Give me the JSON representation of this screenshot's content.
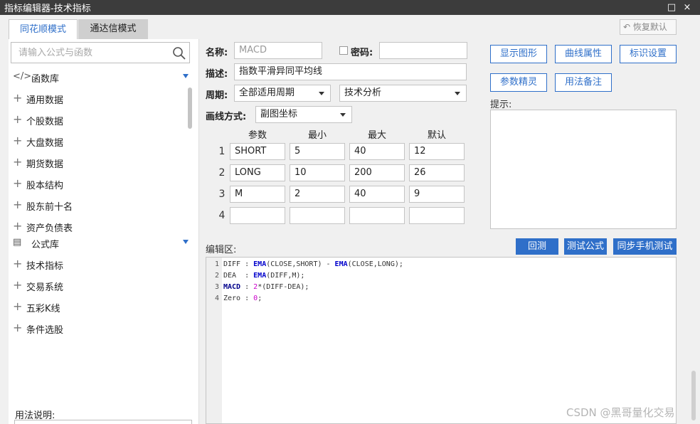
{
  "window": {
    "title": "指标编辑器-技术指标",
    "minimize_glyph": "□",
    "close_glyph": "×"
  },
  "tabs": [
    {
      "label": "同花顺模式",
      "active": true
    },
    {
      "label": "通达信模式",
      "active": false
    }
  ],
  "restore_button": {
    "label": "恢复默认",
    "icon": "undo-icon",
    "glyph": "↶"
  },
  "sidebar": {
    "search": {
      "placeholder": "请输入公式与函数",
      "icon": "search-icon"
    },
    "function_lib": {
      "label": "函数库",
      "icon_glyph": "</>"
    },
    "function_items": [
      "通用数据",
      "个股数据",
      "大盘数据",
      "期货数据",
      "股本结构",
      "股东前十名",
      "资产负债表"
    ],
    "formula_lib": {
      "label": "公式库",
      "icon_glyph": "▤"
    },
    "formula_items": [
      "技术指标",
      "交易系统",
      "五彩K线",
      "条件选股"
    ],
    "plus_glyph": "+",
    "usage_label": "用法说明:"
  },
  "form": {
    "name": {
      "label": "名称:",
      "value": "MACD"
    },
    "password": {
      "label": "密码:",
      "value": ""
    },
    "description": {
      "label": "描述:",
      "value": "指数平滑异同平均线"
    },
    "period": {
      "label": "周期:",
      "value": "全部适用周期"
    },
    "category": {
      "value": "技术分析"
    },
    "draw_mode": {
      "label": "画线方式:",
      "value": "副图坐标"
    }
  },
  "params": {
    "headers": [
      "参数",
      "最小",
      "最大",
      "默认"
    ],
    "rows": [
      {
        "num": "1",
        "name": "SHORT",
        "min": "5",
        "max": "40",
        "default": "12"
      },
      {
        "num": "2",
        "name": "LONG",
        "min": "10",
        "max": "200",
        "default": "26"
      },
      {
        "num": "3",
        "name": "M",
        "min": "2",
        "max": "40",
        "default": "9"
      },
      {
        "num": "4",
        "name": "",
        "min": "",
        "max": "",
        "default": ""
      }
    ]
  },
  "right_buttons": {
    "show_graph": "显示图形",
    "curve_props": "曲线属性",
    "marker_settings": "标识设置",
    "param_wizard": "参数精灵",
    "usage_notes": "用法备注"
  },
  "hint_label": "提示:",
  "editor": {
    "label": "编辑区:",
    "buttons": {
      "backtest": "回测",
      "test_formula": "测试公式",
      "sync_mobile": "同步手机测试"
    },
    "line_numbers": [
      "1",
      "2",
      "3",
      "4"
    ],
    "lines": [
      [
        {
          "t": "DIFF : ",
          "k": "plain"
        },
        {
          "t": "EMA",
          "k": "fn"
        },
        {
          "t": "(CLOSE,SHORT) - ",
          "k": "plain"
        },
        {
          "t": "EMA",
          "k": "fn"
        },
        {
          "t": "(CLOSE,LONG);",
          "k": "plain"
        }
      ],
      [
        {
          "t": "DEA  : ",
          "k": "plain"
        },
        {
          "t": "EMA",
          "k": "fn"
        },
        {
          "t": "(DIFF,M);",
          "k": "plain"
        }
      ],
      [
        {
          "t": "MACD",
          "k": "var"
        },
        {
          "t": " : ",
          "k": "plain"
        },
        {
          "t": "2",
          "k": "num"
        },
        {
          "t": "*(DIFF-DEA);",
          "k": "plain"
        }
      ],
      [
        {
          "t": "Zero : ",
          "k": "plain"
        },
        {
          "t": "0",
          "k": "num"
        },
        {
          "t": ";",
          "k": "plain"
        }
      ]
    ]
  },
  "watermark": "CSDN @黑哥量化交易",
  "colors": {
    "accent": "#2f6fc9",
    "titlebar": "#3c3c3c"
  }
}
